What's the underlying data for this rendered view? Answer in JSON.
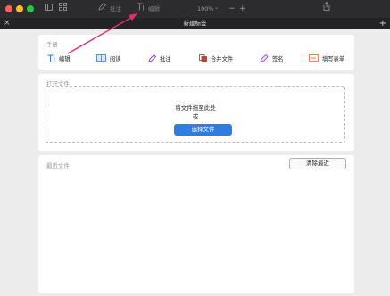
{
  "titlebar": {
    "annotate_label": "批注",
    "edit_label": "编辑",
    "zoom_value": "100%",
    "zoom_chevron": "⌄",
    "zoom_out": "−",
    "zoom_in": "+"
  },
  "tabbar": {
    "title": "新建标签",
    "close": "×",
    "new_tab": "+"
  },
  "handbook": {
    "title": "手册",
    "tools": [
      {
        "label": "编辑",
        "icon": "text-edit-icon"
      },
      {
        "label": "阅读",
        "icon": "book-icon"
      },
      {
        "label": "批注",
        "icon": "pen-icon"
      },
      {
        "label": "合并文件",
        "icon": "merge-files-icon"
      },
      {
        "label": "签名",
        "icon": "signature-pen-icon"
      },
      {
        "label": "填写表单",
        "icon": "form-icon"
      }
    ]
  },
  "open_file": {
    "title": "打开文件",
    "drop_text": "将文件拖至此处",
    "or_text": "或",
    "choose_button": "选择文件"
  },
  "recent": {
    "title": "最近文件",
    "clear_button": "清除最近"
  },
  "colors": {
    "accent": "#2f7de1",
    "annotation_arrow": "#e0316f"
  }
}
